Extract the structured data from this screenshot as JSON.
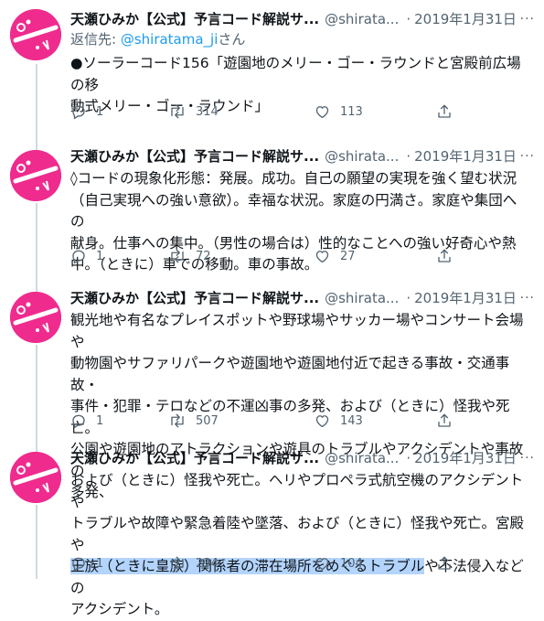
{
  "colors": {
    "avatar": "#ef2b8e",
    "text": "#0f1419",
    "secondary": "#536471",
    "link": "#1d9bf0",
    "highlight": "#b3d4fd"
  },
  "icons": {
    "reply": "speech-bubble-icon",
    "retweet": "retweet-icon",
    "like": "heart-icon",
    "share": "share-icon",
    "more": "more-dots-icon"
  },
  "tweets": [
    {
      "name": "天瀬ひみか【公式】予言コード解説サ...",
      "handle": "@shirata...",
      "dot": "·",
      "date": "2019年1月31日",
      "more": "···",
      "reply_to_prefix": "返信先: ",
      "reply_to_handle": "@shiratama_ji",
      "reply_to_suffix": "さん",
      "lines": [
        "●ソーラーコード156「遊園地のメリー・ゴー・ラウンドと宮殿前広場の移",
        "動式メリー・ゴー・ラウンド」"
      ],
      "replies": "1",
      "retweets": "314",
      "likes": "113"
    },
    {
      "name": "天瀬ひみか【公式】予言コード解説サ...",
      "handle": "@shirata...",
      "dot": "·",
      "date": "2019年1月31日",
      "more": "···",
      "lines": [
        "◊コードの現象化形態：発展。成功。自己の願望の実現を強く望む状況",
        "（自己実現への強い意欲）。幸福な状況。家庭の円満さ。家庭や集団への",
        "献身。仕事への集中。（男性の場合は）性的なことへの強い好奇心や熱",
        "中。（ときに）車での移動。車の事故。"
      ],
      "replies": "1",
      "retweets": "72",
      "likes": "27"
    },
    {
      "name": "天瀬ひみか【公式】予言コード解説サ...",
      "handle": "@shirata...",
      "dot": "·",
      "date": "2019年1月31日",
      "more": "···",
      "lines": [
        "観光地や有名なプレイスポットや野球場やサッカー場やコンサート会場や",
        "動物園やサファリパークや遊園地や遊園地付近で起きる事故・交通事故・",
        "事件・犯罪・テロなどの不運凶事の多発、および（ときに）怪我や死亡。",
        "公園や遊園地のアトラクションや遊具のトラブルやアクシデントや事故の",
        "多発、"
      ],
      "replies": "1",
      "retweets": "507",
      "likes": "143"
    },
    {
      "name": "天瀬ひみか【公式】予言コード解説サ...",
      "handle": "@shirata...",
      "dot": "·",
      "date": "2019年1月31日",
      "more": "···",
      "lines": [
        "および（ときに）怪我や死亡。ヘリやプロペラ式航空機のアクシデントや",
        "トラブルや故障や緊急着陸や墜落、および（ときに）怪我や死亡。宮殿や"
      ],
      "line_hl_a": "王族（ときに皇族）関係者の滞在場所をめぐるトラブル",
      "line_hl_b": "や不法侵入などの",
      "line_last": "アクシデント。",
      "replies": "1",
      "retweets": "234",
      "likes": "104"
    }
  ]
}
